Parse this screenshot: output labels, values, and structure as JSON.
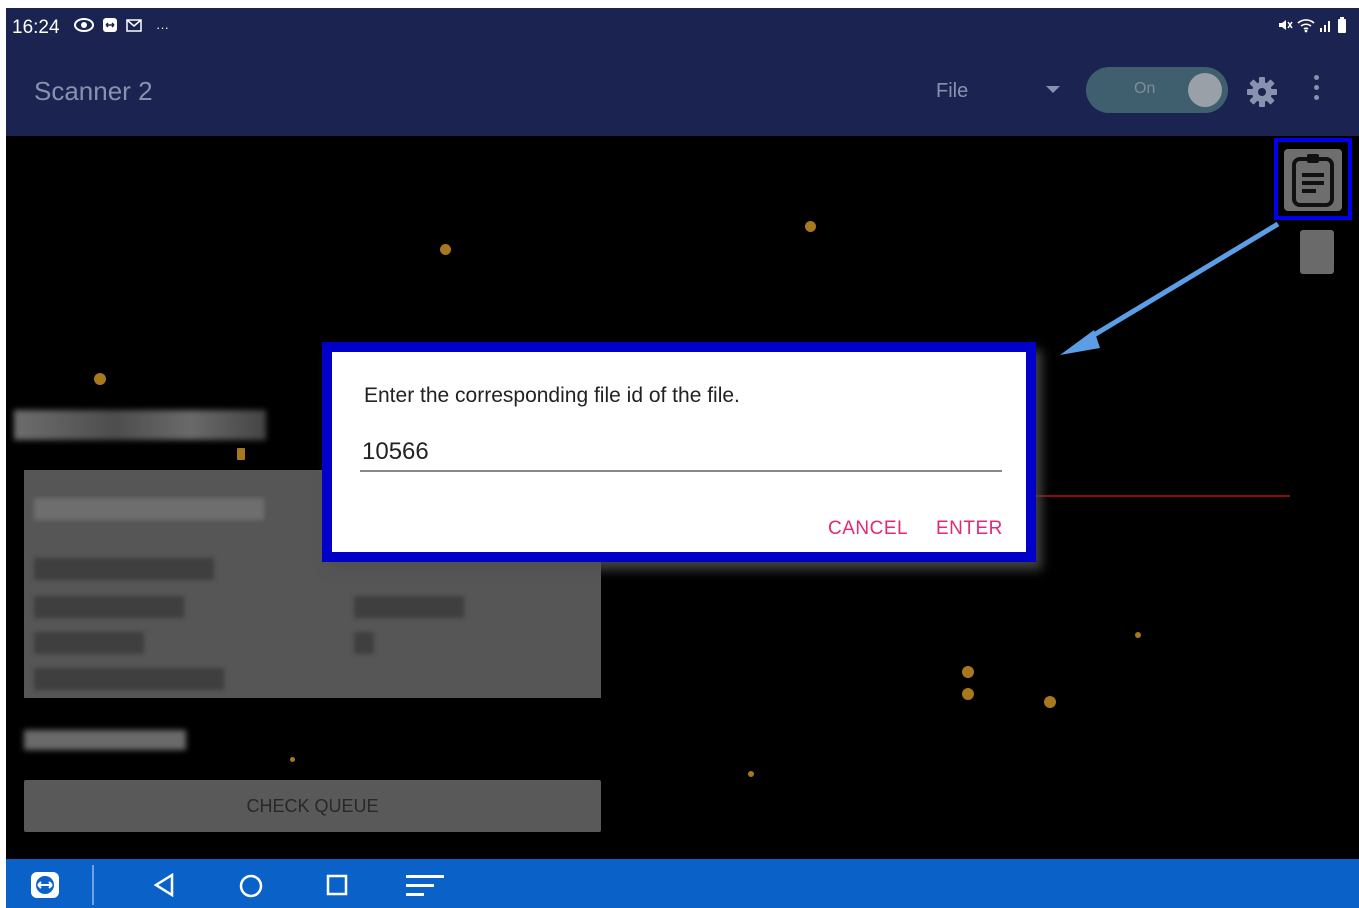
{
  "status_bar": {
    "time": "16:24",
    "left_icons": [
      "eye-icon",
      "teamviewer-icon",
      "mail-icon",
      "more-dots"
    ],
    "more_label": "···",
    "right_icons": [
      "mute-icon",
      "wifi-icon",
      "signal-icon",
      "battery-icon"
    ]
  },
  "app_bar": {
    "title": "Scanner 2",
    "mode_select": {
      "selected": "File"
    },
    "toggle": {
      "label": "On",
      "state": "on"
    },
    "icons": [
      "gear-icon",
      "overflow-menu-icon"
    ],
    "colors": {
      "bar": "#1b2350",
      "text": "#8891ad"
    }
  },
  "main": {
    "check_queue_label": "CHECK QUEUE",
    "clipboard_button_icon": "clipboard-list-icon",
    "highlight_color": "#0000ee",
    "arrow_color": "#5c9ee6"
  },
  "dialog": {
    "message": "Enter the corresponding file id of the file.",
    "input_value": "10566",
    "cancel_label": "CANCEL",
    "enter_label": "ENTER",
    "accent_color": "#e0297a",
    "highlight_color": "#0000c8"
  },
  "nav_bar": {
    "icons": [
      "teamviewer-icon",
      "back-icon",
      "home-icon",
      "recents-icon",
      "menu-icon"
    ],
    "color": "#0a62c9"
  }
}
